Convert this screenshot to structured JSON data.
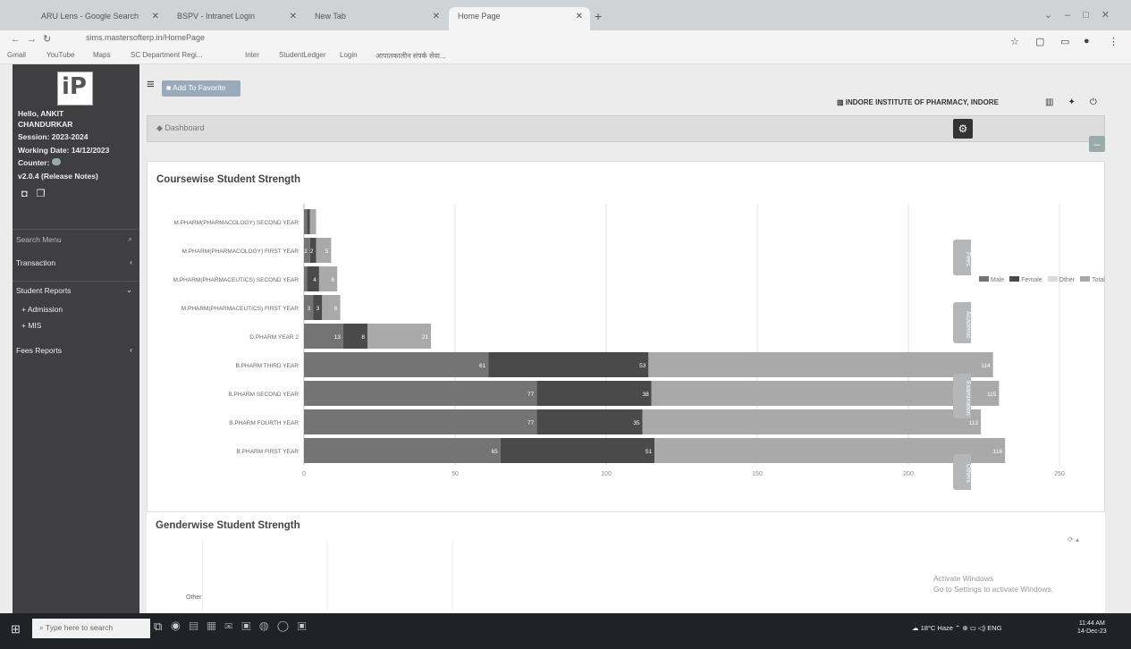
{
  "browser": {
    "tabs": [
      {
        "label": "ARU Lens - Google Search"
      },
      {
        "label": "BSPV - Intranet Login"
      },
      {
        "label": "New Tab"
      },
      {
        "label": "Home Page"
      }
    ],
    "url": "sims.mastersofterp.in/HomePage",
    "bookmarks": [
      "Gmail",
      "YouTube",
      "Maps",
      "SC Department Regi...",
      "Inter",
      "StudentLedger",
      "Login",
      "आपातकालीन संपर्क सेवा..."
    ]
  },
  "sidebar": {
    "greeting": "Hello, ANKIT",
    "name": "CHANDURKAR",
    "session": "Session: 2023-2024",
    "working_date": "Working Date: 14/12/2023",
    "counter": "Counter:",
    "version": "v2.0.4 (Release Notes)",
    "search_menu": "Search Menu",
    "menu": [
      {
        "label": "Transaction"
      },
      {
        "label": "Student Reports"
      },
      {
        "label": "Admission"
      },
      {
        "label": "MIS"
      },
      {
        "label": "Fees Reports"
      }
    ]
  },
  "header": {
    "add_favorite": "Add To Favorite",
    "institute": "INDORE INSTITUTE OF PHARMACY, INDORE",
    "breadcrumb": "Dashboard"
  },
  "side_tabs": [
    "Fees",
    "Academic",
    "Examination",
    "Others"
  ],
  "chart_title": "Coursewise Student Strength",
  "chart2_title": "Genderwise Student Strength",
  "chart2_label": "Other",
  "watermark": {
    "line1": "Activate Windows",
    "line2": "Go to Settings to activate Windows."
  },
  "chart_data": {
    "type": "bar",
    "orientation": "horizontal",
    "stacked": true,
    "categories": [
      "M.PHARM(PHARMACOLOGY) SECOND YEAR",
      "M.PHARM(PHARMACOLOGY) FIRST YEAR",
      "M.PHARM(PHARMACEUTICS) SECOND YEAR",
      "M.PHARM(PHARMACEUTICS) FIRST YEAR",
      "D.PHARM YEAR 2",
      "B.PHARM THIRD YEAR",
      "B.PHARM SECOND YEAR",
      "B.PHARM FOURTH YEAR",
      "B.PHARM FIRST YEAR"
    ],
    "series": [
      {
        "name": "Male",
        "color": "#747474",
        "values": [
          1,
          2,
          1,
          3,
          13,
          61,
          77,
          77,
          65
        ]
      },
      {
        "name": "Female",
        "color": "#4a4a4a",
        "values": [
          1,
          2,
          4,
          3,
          8,
          53,
          38,
          35,
          51
        ]
      },
      {
        "name": "Other",
        "color": "#dcdcdc",
        "values": [
          0,
          0,
          0,
          0,
          0,
          0,
          0,
          0,
          0
        ]
      },
      {
        "name": "Total",
        "color": "#a9a9a9",
        "values": [
          2,
          5,
          6,
          6,
          21,
          114,
          115,
          112,
          116
        ]
      }
    ],
    "segment_labels": [
      [
        "",
        "",
        ""
      ],
      [
        "2",
        "2",
        "5"
      ],
      [
        "1",
        "4",
        "6"
      ],
      [
        "3",
        "3",
        "6"
      ],
      [
        "13",
        "8",
        "21"
      ],
      [
        "61",
        "53",
        "114"
      ],
      [
        "77",
        "38",
        "115"
      ],
      [
        "77",
        "35",
        "112"
      ],
      [
        "65",
        "51",
        "116"
      ]
    ],
    "x_ticks": [
      0,
      50,
      100,
      150,
      200,
      250
    ],
    "xlim": [
      0,
      250
    ],
    "legend_position": "top-right",
    "grid": true
  }
}
